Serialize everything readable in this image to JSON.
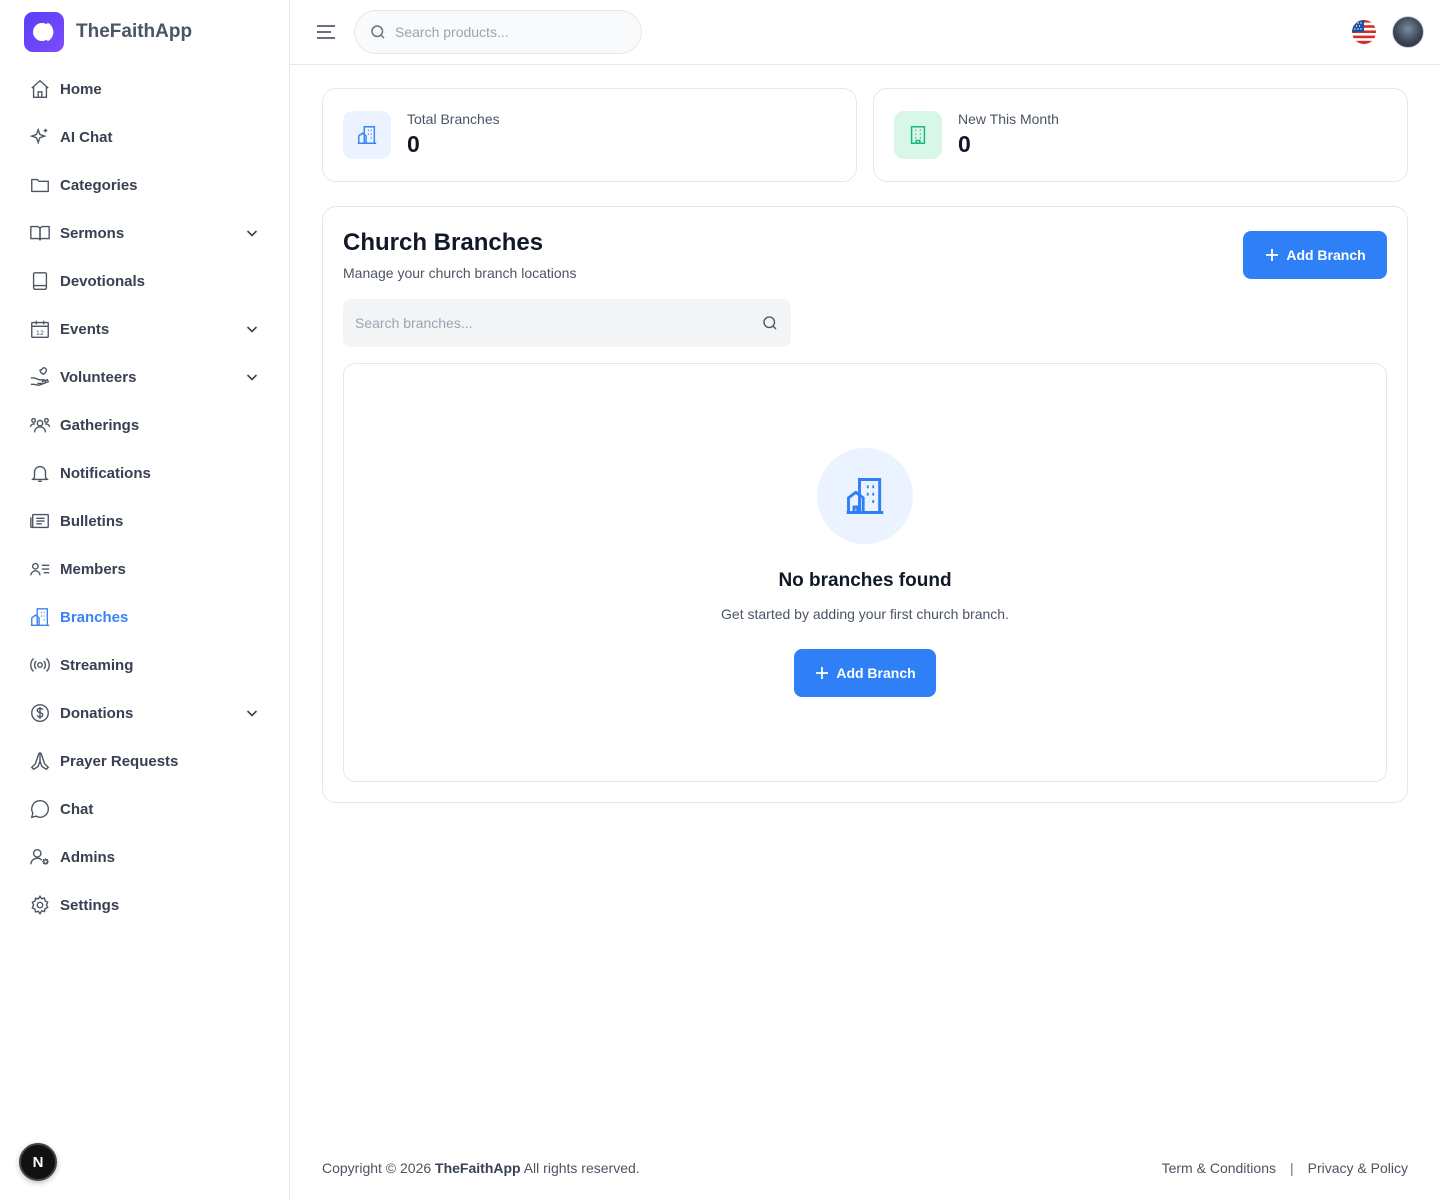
{
  "app": {
    "name": "TheFaithApp"
  },
  "sidebar": {
    "items": [
      {
        "label": "Home",
        "icon": "home-icon",
        "has_chevron": false
      },
      {
        "label": "AI Chat",
        "icon": "sparkle-icon",
        "has_chevron": false
      },
      {
        "label": "Categories",
        "icon": "folder-icon",
        "has_chevron": false
      },
      {
        "label": "Sermons",
        "icon": "book-open-icon",
        "has_chevron": true
      },
      {
        "label": "Devotionals",
        "icon": "book-icon",
        "has_chevron": false
      },
      {
        "label": "Events",
        "icon": "calendar-icon",
        "has_chevron": true
      },
      {
        "label": "Volunteers",
        "icon": "hand-heart-icon",
        "has_chevron": true
      },
      {
        "label": "Gatherings",
        "icon": "users-icon",
        "has_chevron": false
      },
      {
        "label": "Notifications",
        "icon": "bell-icon",
        "has_chevron": false
      },
      {
        "label": "Bulletins",
        "icon": "newspaper-icon",
        "has_chevron": false
      },
      {
        "label": "Members",
        "icon": "user-list-icon",
        "has_chevron": false
      },
      {
        "label": "Branches",
        "icon": "building-icon",
        "has_chevron": false,
        "active": true
      },
      {
        "label": "Streaming",
        "icon": "broadcast-icon",
        "has_chevron": false
      },
      {
        "label": "Donations",
        "icon": "dollar-circle-icon",
        "has_chevron": true
      },
      {
        "label": "Prayer Requests",
        "icon": "praying-hands-icon",
        "has_chevron": false
      },
      {
        "label": "Chat",
        "icon": "chat-bubble-icon",
        "has_chevron": false
      },
      {
        "label": "Admins",
        "icon": "user-cog-icon",
        "has_chevron": false
      },
      {
        "label": "Settings",
        "icon": "gear-icon",
        "has_chevron": false
      }
    ],
    "badge": "N"
  },
  "header": {
    "search": {
      "placeholder": "Search products...",
      "value": ""
    }
  },
  "stats": [
    {
      "label": "Total Branches",
      "value": "0",
      "icon": "building-icon",
      "icon_bg": "#eaf3ff",
      "icon_color": "#3b82f6"
    },
    {
      "label": "New This Month",
      "value": "0",
      "icon": "office-building-icon",
      "icon_bg": "#d9f7e8",
      "icon_color": "#10b981"
    }
  ],
  "panel": {
    "title": "Church Branches",
    "subtitle": "Manage your church branch locations",
    "add_label": "Add Branch",
    "search": {
      "placeholder": "Search branches...",
      "value": ""
    },
    "empty": {
      "title": "No branches found",
      "subtitle": "Get started by adding your first church branch.",
      "button_label": "Add Branch"
    }
  },
  "footer": {
    "copyright_prefix": "Copyright © 2026",
    "copyright_brand": "TheFaithApp",
    "copyright_suffix": "All rights reserved.",
    "terms": "Term & Conditions",
    "separator": "|",
    "privacy": "Privacy & Policy"
  },
  "colors": {
    "accent": "#2f80f7",
    "brand": "#5b3df5",
    "active_nav": "#3b82f6"
  }
}
